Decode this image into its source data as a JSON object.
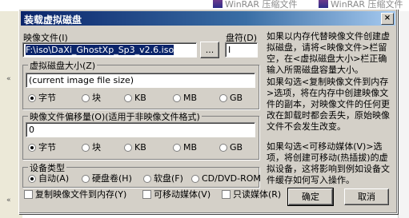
{
  "background": {
    "tab_labels": [
      "WinRAR 压缩文件",
      "WinRAR 压缩文件"
    ]
  },
  "dialog": {
    "title": "装载虚拟磁盘",
    "close_glyph": "×"
  },
  "image_file": {
    "label": "映像文件(I)",
    "value": "F:\\iso\\DaXi_GhostXp_Sp3_v2.6.iso",
    "browse_label": "..."
  },
  "drive": {
    "label": "盘符(D)",
    "value": "I"
  },
  "size_group": {
    "legend": "虚拟磁盘大小(Z)",
    "value": "(current image file size)",
    "units": [
      "字节",
      "块",
      "KB",
      "MB",
      "GB"
    ],
    "selected": "字节"
  },
  "offset_group": {
    "legend": "映像文件偏移量(O)(适用于非映像文件格式)",
    "value": "0",
    "units": [
      "字节",
      "块",
      "KB",
      "MB",
      "GB"
    ],
    "selected": "字节"
  },
  "device_group": {
    "legend": "设备类型",
    "options": [
      "自动(A)",
      "硬盘卷(H)",
      "软盘(F)",
      "CD/DVD-ROM"
    ],
    "selected": "自动(A)"
  },
  "checkboxes": {
    "copy_to_memory": "复制映像文件到内存(Y)",
    "removable": "可移动媒体(V)",
    "readonly": "只读媒体(R)"
  },
  "buttons": {
    "ok": "确定",
    "cancel": "取消"
  },
  "help": {
    "para1": "如果以内存代替映像文件创建虚拟磁盘，请将<映像文件>栏留空，在<虚拟磁盘大小>栏正确输入所需磁盘容量大小。",
    "para2": "如果勾选<复制映像文件到内存>选项，将在内存中创建映像文件的副本，对映像文件的任何更改在卸载时都会丢失，原始映像文件不会发生改变。",
    "para3": "如果勾选<可移动媒体(V)>选项，将创建可移动(热插拔)的虚拟设备，这将影响到例如设备文件缓存如何写入操作。"
  }
}
